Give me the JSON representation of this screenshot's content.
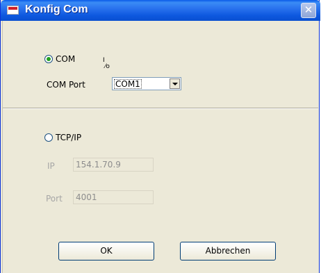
{
  "window": {
    "title": "Konfig Com",
    "close_glyph": "✕"
  },
  "com": {
    "radio_label": "COM",
    "selected": true,
    "port_label": "COM Port",
    "port_icon": "io-icon",
    "port_icon_text": "I/O",
    "port_value": "COM1"
  },
  "tcp": {
    "radio_label": "TCP/IP",
    "selected": false,
    "ip_label": "IP",
    "ip_value": "154.1.70.9",
    "port_label": "Port",
    "port_value": "4001"
  },
  "buttons": {
    "ok": "OK",
    "cancel": "Abbrechen"
  }
}
